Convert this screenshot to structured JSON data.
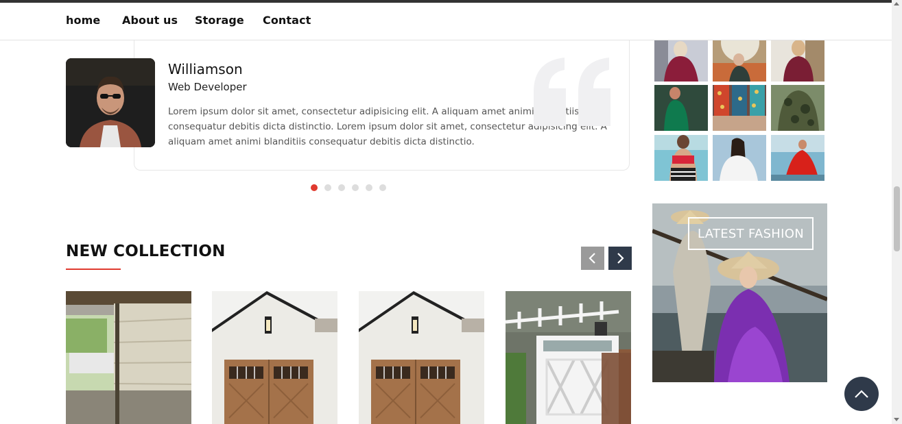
{
  "nav": {
    "items": [
      {
        "label": "home"
      },
      {
        "label": "About us"
      },
      {
        "label": "Storage"
      },
      {
        "label": "Contact"
      }
    ]
  },
  "testimonial": {
    "name": "Williamson",
    "role": "Web Developer",
    "text": "Lorem ipsum dolor sit amet, consectetur adipisicing elit. A aliquam amet animi blanditiis consequatur debitis dicta distinctio. Lorem ipsum dolor sit amet, consectetur adipisicing elit. A aliquam amet animi blanditiis consequatur debitis dicta distinctio.",
    "dots_count": 6,
    "active_dot": 1,
    "icon": "quote-icon"
  },
  "collection": {
    "title": "NEW COLLECTION",
    "products": [
      {
        "image": "garage-interior-photo"
      },
      {
        "image": "white-garage-wood-door-photo"
      },
      {
        "image": "white-garage-wood-door-photo"
      },
      {
        "image": "garage-pergola-photo"
      }
    ]
  },
  "sidebar": {
    "gallery": [
      {
        "image": "woman-red-dress"
      },
      {
        "image": "woman-umbrella"
      },
      {
        "image": "woman-maroon-dress"
      },
      {
        "image": "woman-green-dress"
      },
      {
        "image": "patterned-skirts"
      },
      {
        "image": "camouflage-outfit"
      },
      {
        "image": "woman-swimsuit-sea"
      },
      {
        "image": "woman-white-top"
      },
      {
        "image": "woman-red-dress-sea"
      }
    ],
    "banner_label": "LATEST FASHION"
  },
  "colors": {
    "accent": "#e03a2f",
    "dark": "#2f3a4a",
    "inactive_dot": "#dddddd"
  }
}
